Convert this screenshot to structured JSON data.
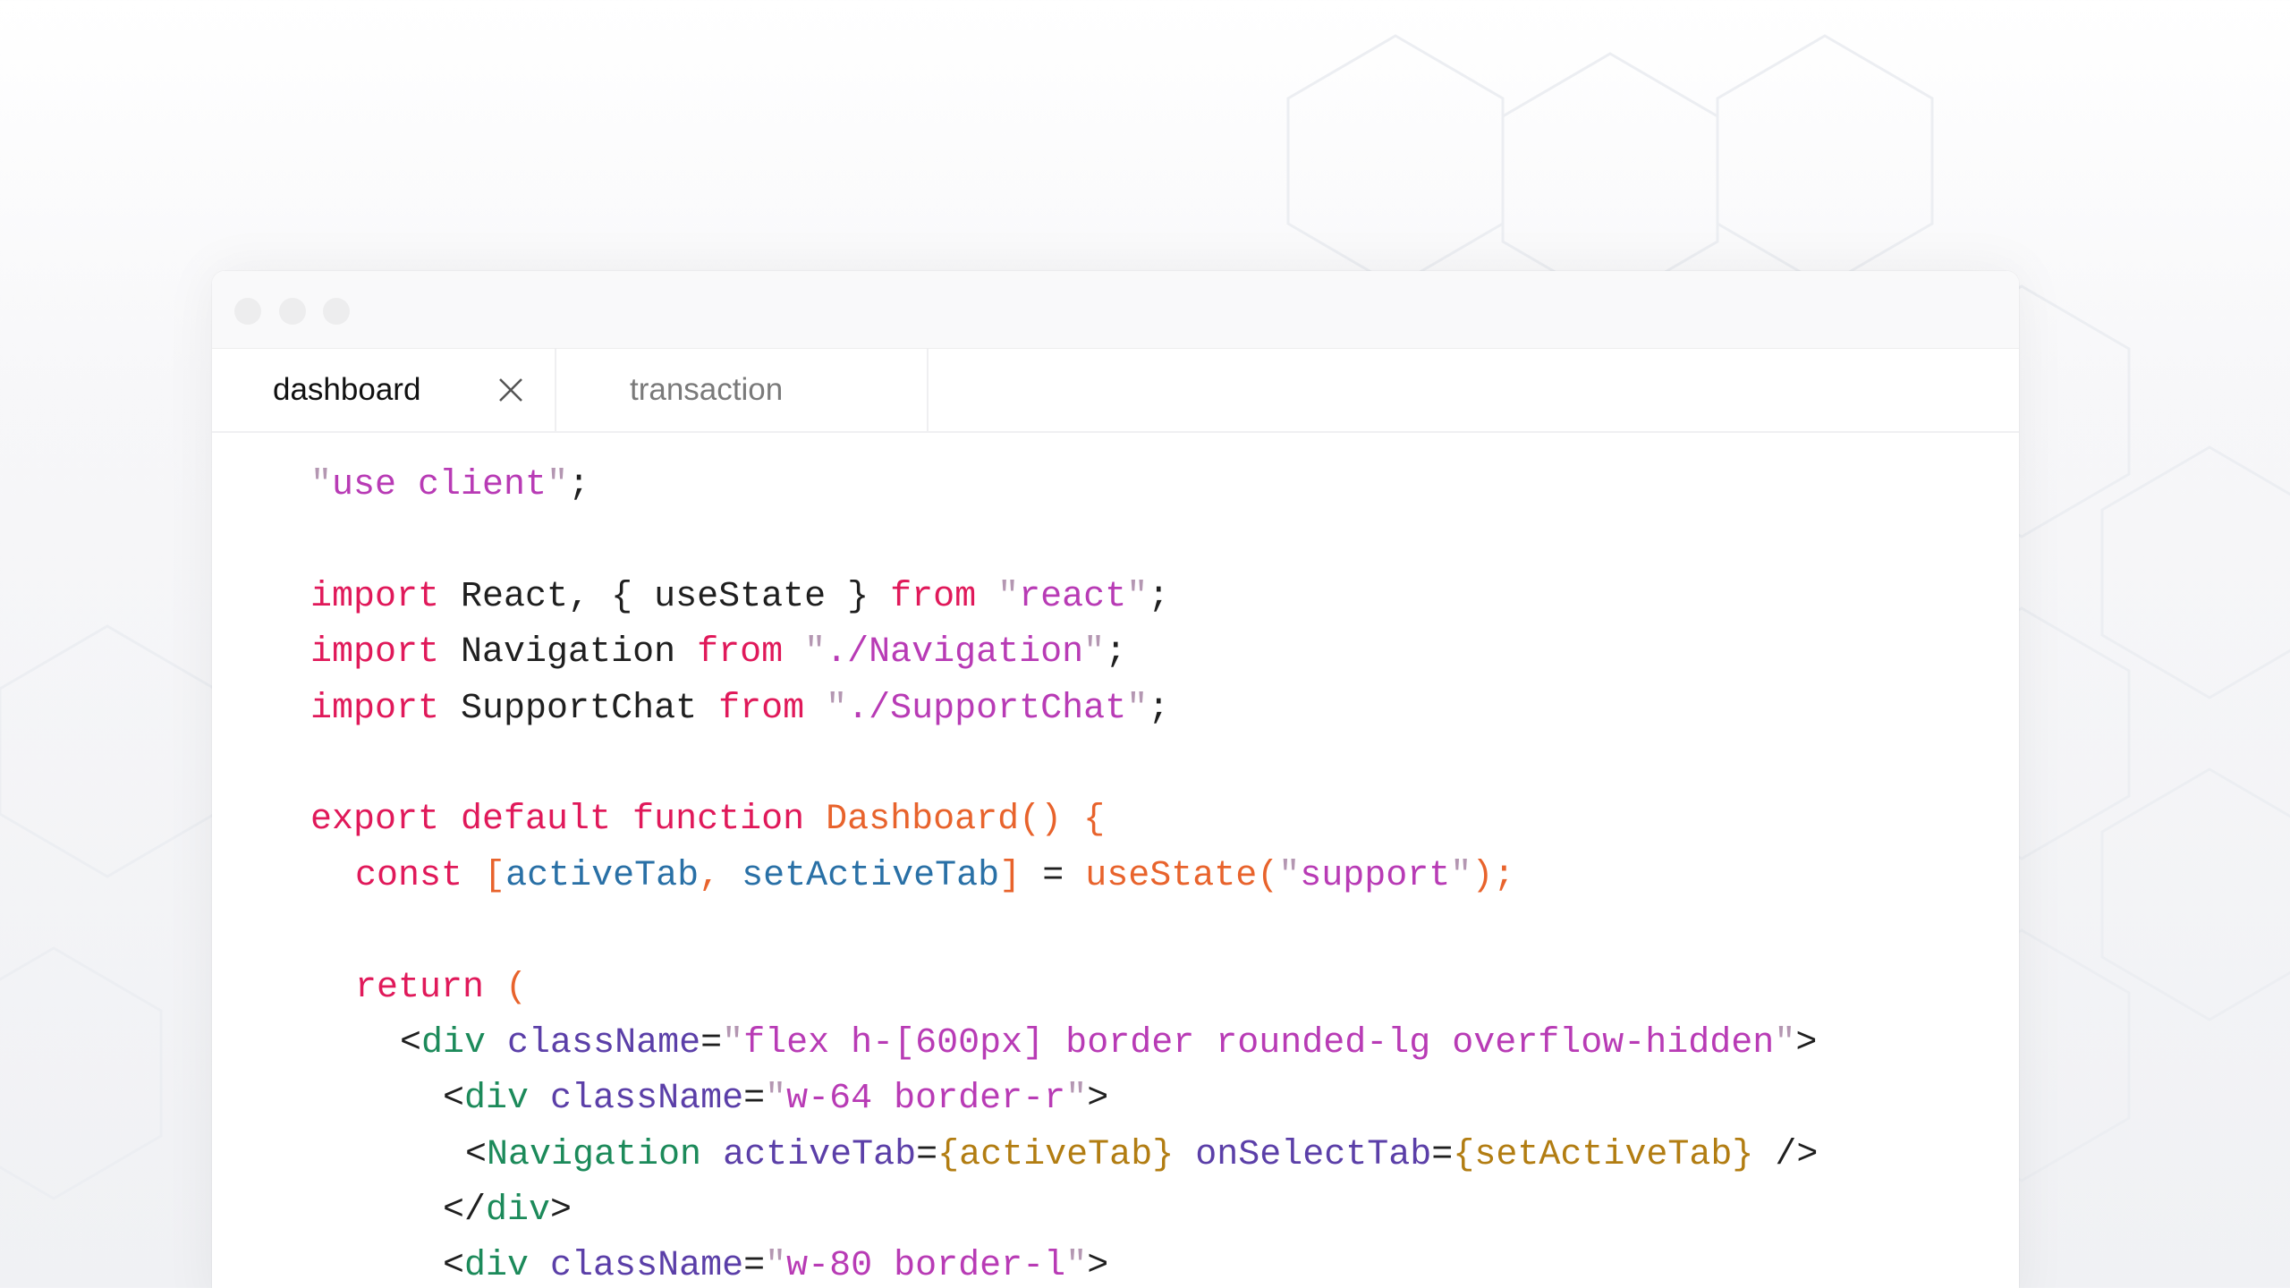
{
  "window": {
    "tabs": [
      {
        "label": "dashboard",
        "active": true
      },
      {
        "label": "transaction",
        "active": false
      }
    ]
  },
  "code": {
    "line1": [
      "\"",
      "use client",
      "\"",
      ";"
    ],
    "line3": [
      "import",
      " React, { useState } ",
      "from",
      " ",
      "\"",
      "react",
      "\"",
      ";"
    ],
    "line4": [
      "import",
      " Navigation ",
      "from",
      " ",
      "\"",
      "./Navigation",
      "\"",
      ";"
    ],
    "line5": [
      "import",
      " SupportChat ",
      "from",
      " ",
      "\"",
      "./SupportChat",
      "\"",
      ";"
    ],
    "line7": [
      "export default function",
      " ",
      "Dashboard() {"
    ],
    "line8": [
      "const",
      " ",
      "[",
      "activeTab",
      ", ",
      "setActiveTab",
      "]",
      " = ",
      "useState(",
      "\"",
      "support",
      "\"",
      ");"
    ],
    "line10": [
      "return",
      " ",
      "("
    ],
    "line11": [
      "<",
      "div",
      " ",
      "className",
      "=",
      "\"",
      "flex h-[600px] border rounded-lg overflow-hidden",
      "\"",
      ">"
    ],
    "line12": [
      "<",
      "div",
      " ",
      "className",
      "=",
      "\"",
      "w-64 border-r",
      "\"",
      ">"
    ],
    "line13": [
      "<",
      "Navigation",
      " ",
      "activeTab",
      "=",
      "{",
      "activeTab",
      "}",
      " ",
      "onSelectTab",
      "=",
      "{",
      "setActiveTab",
      "}",
      " />"
    ],
    "line14": [
      "</",
      "div",
      ">"
    ],
    "line15": [
      "<",
      "div",
      " ",
      "className",
      "=",
      "\"",
      "w-80 border-l",
      "\"",
      ">"
    ]
  },
  "colors": {
    "keyword": "#e0195a",
    "string": "#b83bb5",
    "function": "#e8632c",
    "variable": "#2970a6",
    "tag": "#1c8a5a",
    "attribute": "#5b3fa8",
    "jsx_expression": "#b27d12"
  },
  "icons": {
    "tab_close": "close-icon"
  }
}
